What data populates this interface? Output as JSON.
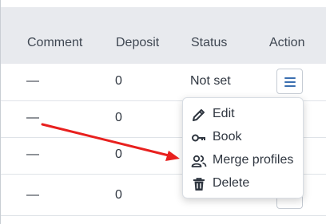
{
  "table": {
    "headers": {
      "comment": "Comment",
      "deposit": "Deposit",
      "status": "Status",
      "action": "Action"
    },
    "rows": [
      {
        "comment": "—",
        "deposit": "0",
        "status": "Not set"
      },
      {
        "comment": "—",
        "deposit": "0",
        "status": ""
      },
      {
        "comment": "—",
        "deposit": "0",
        "status": ""
      },
      {
        "comment": "—",
        "deposit": "0",
        "status": ""
      }
    ]
  },
  "menu": {
    "items": [
      {
        "label": "Edit",
        "icon": "pencil-icon"
      },
      {
        "label": "Book",
        "icon": "key-icon"
      },
      {
        "label": "Merge profiles",
        "icon": "users-icon"
      },
      {
        "label": "Delete",
        "icon": "trash-icon"
      }
    ]
  },
  "colors": {
    "header_bg": "#e8eaee",
    "accent": "#3b6fb0",
    "annotation_arrow": "#e8201e"
  }
}
